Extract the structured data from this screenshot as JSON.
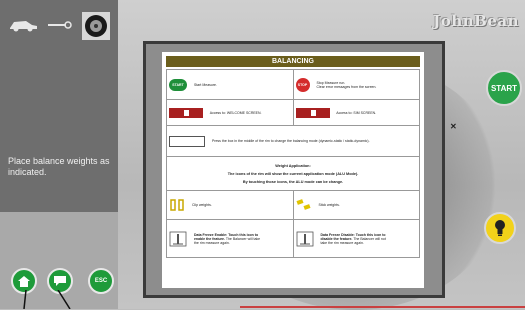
{
  "header": {
    "brand": "JohnBean"
  },
  "left_panel": {
    "message": "Place balance weights as indicated.",
    "bottom_buttons": [
      {
        "icon": "home-icon"
      },
      {
        "icon": "message-icon"
      },
      {
        "label": "ESC"
      }
    ]
  },
  "right_panel": {
    "start_label": "START",
    "bulb_icon": "lightbulb-icon"
  },
  "dialog": {
    "title": "BALANCING",
    "rows": {
      "start_button_label": "START",
      "start_desc": "Start Measure.",
      "stop_button_label": "STOP",
      "stop_desc_1": "Stop Measure run.",
      "stop_desc_2": "Clear error messages from the screen.",
      "welcome_desc": "Access to: WELCOME SCREEN.",
      "sim_desc": "Access to: SIM SCREEN.",
      "box_desc": "Press the box in the middle of the rim to change the balancing mode (dynamic-static / static-dynamic).",
      "weight_title": "Weight Application:",
      "weight_line_1": "The icons of the rim will show the current application mode (ALU Mode).",
      "weight_line_2": "By touching those icons, the ALU mode can be change.",
      "clip_desc": "Clip weights.",
      "stick_desc": "Stick weights.",
      "freeze_a_1": "Data Freeze Enable: Touch this icon to enable the feature.",
      "freeze_a_2": "The Balancer will take the rim measure again.",
      "freeze_b_1": "Data Freeze Disable: Touch this icon to disable the feature.",
      "freeze_b_2": "The Balancer will not take the rim measure again."
    }
  },
  "colors": {
    "accent_green": "#1e9b3a",
    "title_bar": "#6b5e1c",
    "stop_red": "#d42c2c",
    "bulb_yellow": "#f2d21a"
  }
}
